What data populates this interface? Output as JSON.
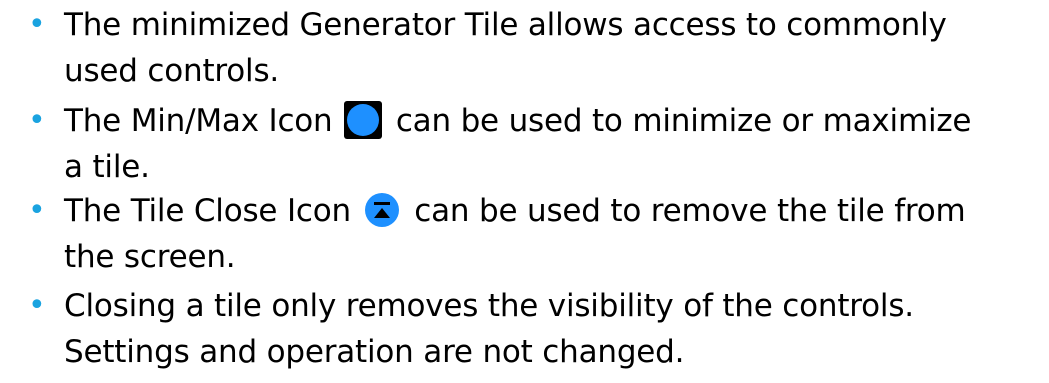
{
  "bullets": [
    {
      "line1": "The minimized Generator Tile allows access to commonly",
      "line2": "used controls."
    },
    {
      "line1_before": "The Min/Max Icon",
      "icon": "min-max-icon",
      "line1_after": "can be used to minimize or maximize",
      "line2": "a tile."
    },
    {
      "line1_before": "The Tile Close Icon",
      "icon": "tile-close-icon",
      "line1_after": "can be used to remove the tile from",
      "line2": "the screen."
    },
    {
      "line1": "Closing a tile only removes the visibility of the controls.",
      "line2": "Settings and operation are not changed."
    }
  ],
  "colors": {
    "bullet": "#1aa3e0",
    "icon_fill": "#1e90ff",
    "icon_background": "#000000",
    "text": "#000000"
  }
}
